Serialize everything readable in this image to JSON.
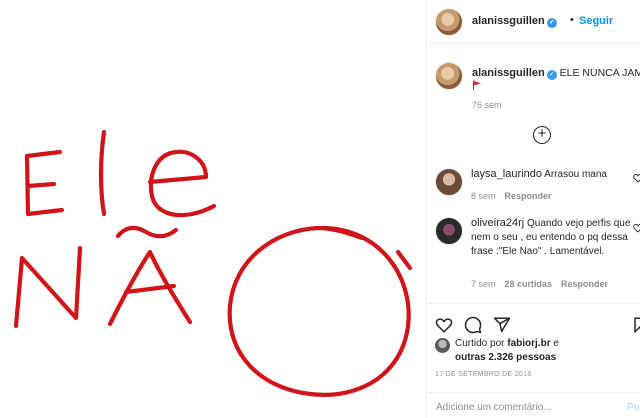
{
  "post_image": {
    "handwriting_line1": "Ele",
    "handwriting_line2": "NÃO",
    "ink_color": "#d01419"
  },
  "header": {
    "username": "alanissguillen",
    "verified": true,
    "separator": "•",
    "follow_label": "Seguir"
  },
  "caption": {
    "username": "alanissguillen",
    "text": "ELE NUNCA JAMÉÉÉ",
    "emoji": "red-flag-icon",
    "age": "76 sem"
  },
  "load_more": "+",
  "comments": [
    {
      "username": "laysa_laurindo",
      "text": "Arrasou mana",
      "age": "8 sem",
      "likes": "",
      "reply_label": "Responder"
    },
    {
      "username": "oliveira24rj",
      "text": "Quando vejo perfis que nem o seu , eu entendo o pq dessa frase :\"Ele Nao\" . Lamentável.",
      "age": "7 sem",
      "likes": "28 curtidas",
      "reply_label": "Responder"
    }
  ],
  "likes": {
    "prefix": "Curtido por ",
    "first_user": "fabiorj.br",
    "joiner": " e",
    "others": "outras 2.326 pessoas"
  },
  "date": "17 DE SETEMBRO DE 2018",
  "add_comment": {
    "placeholder": "Adicione um comentário...",
    "post_label": "Publicar"
  },
  "colors": {
    "accent_blue": "#0095f6",
    "ink_red": "#d01419"
  }
}
